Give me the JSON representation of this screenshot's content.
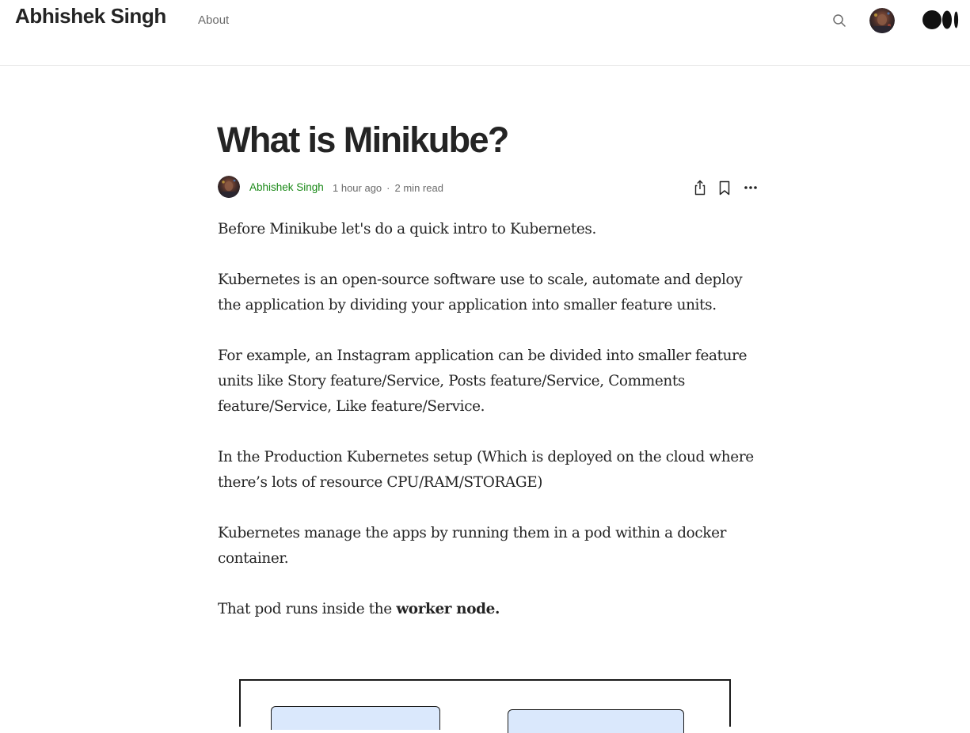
{
  "header": {
    "brand": "Abhishek Singh",
    "nav_about": "About",
    "icons": [
      "search-icon",
      "avatar",
      "medium-logo-icon"
    ]
  },
  "article": {
    "title": "What is Minikube?",
    "author": "Abhishek Singh",
    "published": "1 hour ago",
    "separator": "·",
    "read_time": "2 min read",
    "actions": [
      "share-icon",
      "bookmark-icon",
      "more-icon"
    ],
    "paragraphs": [
      "Before Minikube let's do a quick intro to Kubernetes.",
      "Kubernetes is an open-source software use to scale, automate and deploy the application by dividing your application into smaller feature units.",
      "For example, an Instagram application can be divided into smaller feature units like Story feature/Service, Posts feature/Service, Comments feature/Service, Like feature/Service.",
      "In the Production Kubernetes setup (Which is deployed on the cloud where there’s lots of resource CPU/RAM/STORAGE)",
      "Kubernetes manage the apps by running them in a pod within a docker container."
    ],
    "last_paragraph": {
      "prefix": "That pod runs inside the ",
      "bold": "worker node."
    }
  },
  "colors": {
    "text": "#242424",
    "muted": "#6b6b6b",
    "author_link": "#1a8917",
    "divider": "#e6e6e6",
    "diagram_box": "#dae8fc"
  }
}
